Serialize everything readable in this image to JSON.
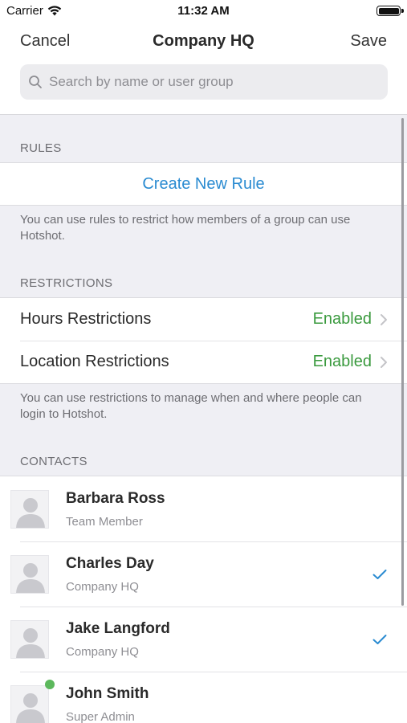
{
  "status_bar": {
    "carrier": "Carrier",
    "time": "11:32 AM",
    "wifi_icon": "wifi-icon",
    "battery_icon": "battery-icon"
  },
  "nav": {
    "cancel_label": "Cancel",
    "title": "Company HQ",
    "save_label": "Save"
  },
  "search": {
    "placeholder": "Search by name or user group",
    "value": ""
  },
  "rules": {
    "header": "RULES",
    "create_label": "Create New Rule",
    "footer": "You can use rules to restrict how members of a group can use Hotshot."
  },
  "restrictions": {
    "header": "RESTRICTIONS",
    "items": [
      {
        "label": "Hours Restrictions",
        "value": "Enabled"
      },
      {
        "label": "Location Restrictions",
        "value": "Enabled"
      }
    ],
    "footer": "You can use restrictions to manage when and where people can login to Hotshot."
  },
  "contacts": {
    "header": "CONTACTS",
    "items": [
      {
        "name": "Barbara Ross",
        "role": "Team Member",
        "selected": false,
        "online": false
      },
      {
        "name": "Charles Day",
        "role": "Company HQ",
        "selected": true,
        "online": false
      },
      {
        "name": "Jake Langford",
        "role": "Company HQ",
        "selected": true,
        "online": false
      },
      {
        "name": "John Smith",
        "role": "Super Admin",
        "selected": false,
        "online": true
      }
    ]
  },
  "colors": {
    "accent_blue": "#2a8bd1",
    "enabled_green": "#3a9a3e",
    "online_green": "#5cb85c",
    "group_background": "#efeff4"
  }
}
